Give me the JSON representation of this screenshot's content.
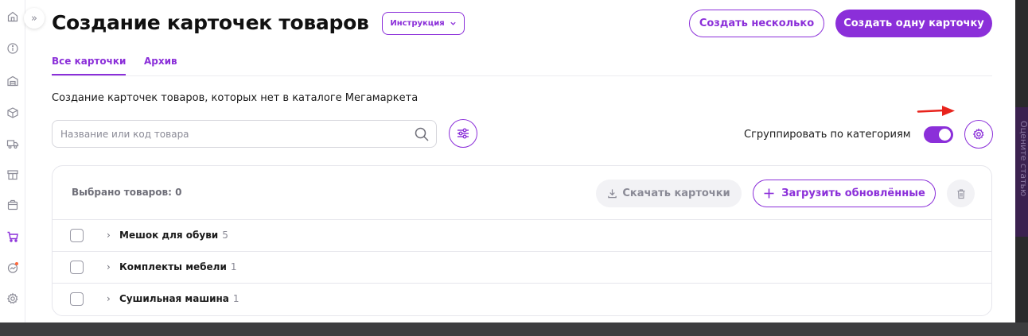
{
  "header": {
    "title": "Создание карточек товаров",
    "instruction_label": "Инструкция",
    "create_several_label": "Создать несколько",
    "create_one_label": "Создать одну карточку"
  },
  "tabs": [
    {
      "label": "Все карточки",
      "active": true
    },
    {
      "label": "Архив",
      "active": false
    }
  ],
  "subtitle": "Создание карточек товаров, которых нет в каталоге Мегамаркета",
  "search": {
    "placeholder": "Название или код товара",
    "value": ""
  },
  "group_by": {
    "label": "Сгруппировать по категориям",
    "enabled": true
  },
  "toolbar": {
    "selected_label": "Выбрано товаров: 0",
    "download_label": "Скачать карточки",
    "upload_label": "Загрузить обновлённые"
  },
  "categories": [
    {
      "name": "Мешок для обуви",
      "count": "5"
    },
    {
      "name": "Комплекты мебели",
      "count": "1"
    },
    {
      "name": "Сушильная машина",
      "count": "1"
    }
  ],
  "side_tab": {
    "label": "Оцените статью"
  },
  "colors": {
    "accent": "#8b2fd9",
    "annotation_arrow": "#e8231c",
    "side_tab_bg": "#3b2150"
  },
  "sidebar_icons": [
    "home-icon",
    "info-icon",
    "warehouse-icon",
    "box-icon",
    "truck-icon",
    "shop-icon",
    "package-icon",
    "cart-icon",
    "analytics-icon",
    "settings-icon"
  ]
}
